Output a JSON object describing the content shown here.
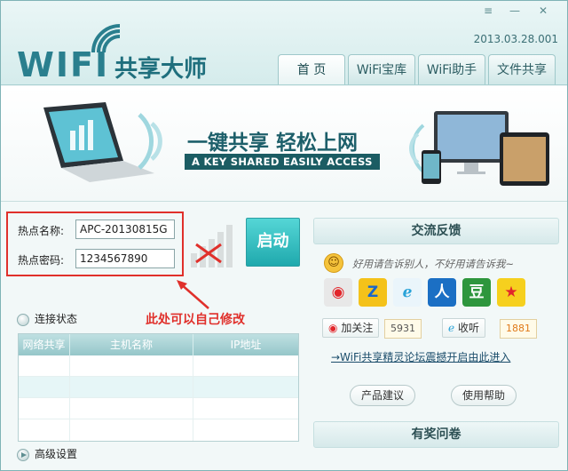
{
  "app": {
    "title_latin": "WIFI",
    "title_cn": "共享大师",
    "version": "2013.03.28.001"
  },
  "window_controls": [
    "≡",
    "—",
    "✕"
  ],
  "tabs": [
    {
      "label": "首  页",
      "active": true
    },
    {
      "label": "WiFi宝库",
      "active": false
    },
    {
      "label": "WiFi助手",
      "active": false
    },
    {
      "label": "文件共享",
      "active": false
    }
  ],
  "banner": {
    "slogan_cn": "一键共享 轻松上网",
    "slogan_en": "A KEY SHARED EASILY ACCESS"
  },
  "hotspot": {
    "name_label": "热点名称:",
    "name_value": "APC-20130815G",
    "password_label": "热点密码:",
    "password_value": "1234567890"
  },
  "start_button": "启动",
  "annotation": "此处可以自己修改",
  "connection_status": {
    "title": "连接状态",
    "columns": [
      "网络共享",
      "主机名称",
      "IP地址"
    ],
    "rows": [
      [
        "",
        "",
        ""
      ],
      [
        "",
        "",
        ""
      ],
      [
        "",
        "",
        ""
      ],
      [
        "",
        "",
        ""
      ]
    ]
  },
  "advanced_settings": "高级设置",
  "feedback": {
    "title": "交流反馈",
    "tagline": "好用请告诉别人，不好用请告诉我~",
    "social_icons": [
      "weibo-icon",
      "qzone-icon",
      "tencent-weibo-icon",
      "renren-icon",
      "douban-icon",
      "qq-space-icon"
    ],
    "follow_label": "加关注",
    "follow_count": "5931",
    "listen_label": "收听",
    "listen_count": "1881",
    "forum_link": "→WiFi共享精灵论坛震撼开启由此进入",
    "suggest_button": "产品建议",
    "help_button": "使用帮助"
  },
  "survey": {
    "title": "有奖问卷"
  },
  "colors": {
    "accent": "#2a7f8e",
    "annotation_red": "#e0302b",
    "start_button": "#2fb8bc"
  }
}
